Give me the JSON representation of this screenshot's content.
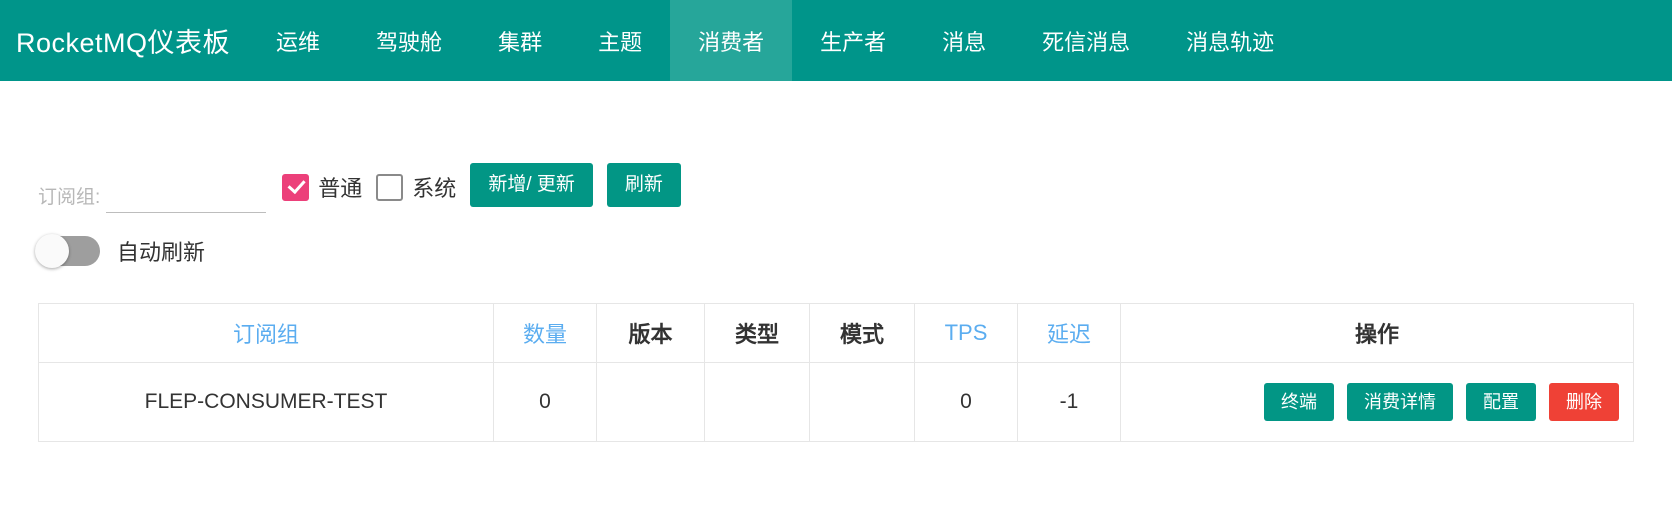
{
  "header": {
    "brand": "RocketMQ仪表板",
    "brand_icon": "none",
    "nav_items": [
      {
        "label": "运维",
        "active": false
      },
      {
        "label": "驾驶舱",
        "active": false
      },
      {
        "label": "集群",
        "active": false
      },
      {
        "label": "主题",
        "active": false
      },
      {
        "label": "消费者",
        "active": true
      },
      {
        "label": "生产者",
        "active": false
      },
      {
        "label": "消息",
        "active": false
      },
      {
        "label": "死信消息",
        "active": false
      },
      {
        "label": "消息轨迹",
        "active": false
      }
    ],
    "accent_color": "#00958a",
    "active_tab_color": "#26a69a"
  },
  "filters": {
    "group_label": "订阅组:",
    "group_value": "",
    "group_placeholder": "",
    "normal_checkbox": {
      "label": "普通",
      "checked": true,
      "color": "#ec407a"
    },
    "system_checkbox": {
      "label": "系统",
      "checked": false
    },
    "add_update_button": "新增/ 更新",
    "refresh_button": "刷新",
    "auto_refresh_label": "自动刷新",
    "auto_refresh_on": false
  },
  "table": {
    "columns": [
      {
        "label": "订阅组",
        "sortable": true,
        "key": "group"
      },
      {
        "label": "数量",
        "sortable": true,
        "key": "count"
      },
      {
        "label": "版本",
        "sortable": false,
        "key": "version"
      },
      {
        "label": "类型",
        "sortable": false,
        "key": "type"
      },
      {
        "label": "模式",
        "sortable": false,
        "key": "mode"
      },
      {
        "label": "TPS",
        "sortable": true,
        "key": "tps"
      },
      {
        "label": "延迟",
        "sortable": true,
        "key": "delay"
      },
      {
        "label": "操作",
        "sortable": false,
        "key": "actions"
      }
    ],
    "rows": [
      {
        "group": "FLEP-CONSUMER-TEST",
        "count": "0",
        "version": "",
        "type": "",
        "mode": "",
        "tps": "0",
        "delay": "-1",
        "actions": [
          {
            "label": "终端",
            "style": "teal"
          },
          {
            "label": "消费详情",
            "style": "teal"
          },
          {
            "label": "配置",
            "style": "teal"
          },
          {
            "label": "删除",
            "style": "red"
          }
        ]
      }
    ]
  },
  "colors": {
    "teal_button": "#029685",
    "red_button": "#ef4136",
    "sortable_header": "#5badf0",
    "checkbox_checked": "#ec407a"
  }
}
